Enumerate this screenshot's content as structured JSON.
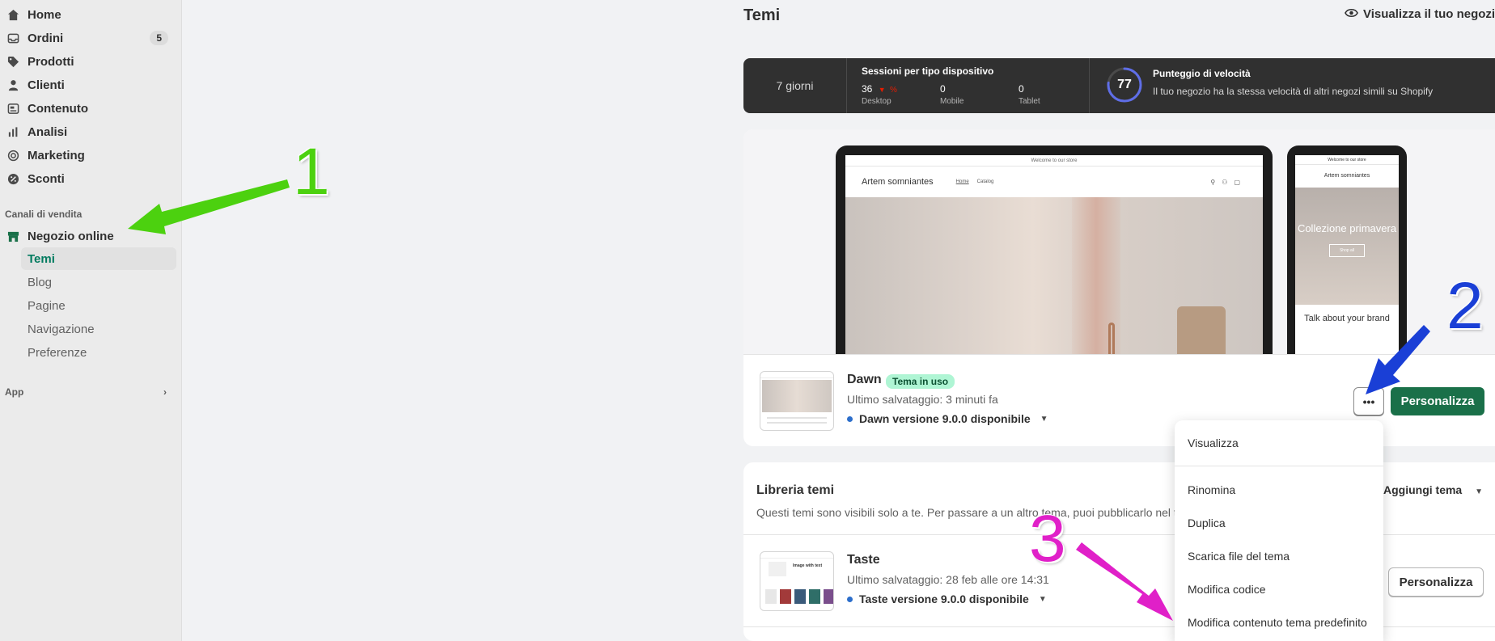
{
  "sidebar": {
    "items": [
      {
        "label": "Home",
        "icon": "home-icon"
      },
      {
        "label": "Ordini",
        "icon": "inbox-icon",
        "badge": "5"
      },
      {
        "label": "Prodotti",
        "icon": "tag-icon"
      },
      {
        "label": "Clienti",
        "icon": "person-icon"
      },
      {
        "label": "Contenuto",
        "icon": "content-icon"
      },
      {
        "label": "Analisi",
        "icon": "bar-chart-icon"
      },
      {
        "label": "Marketing",
        "icon": "target-icon"
      },
      {
        "label": "Sconti",
        "icon": "discount-icon"
      }
    ],
    "section_label": "Canali di vendita",
    "channel": {
      "label": "Negozio online",
      "icon": "store-icon"
    },
    "subitems": [
      {
        "label": "Temi",
        "active": true
      },
      {
        "label": "Blog"
      },
      {
        "label": "Pagine"
      },
      {
        "label": "Navigazione"
      },
      {
        "label": "Preferenze"
      }
    ],
    "app_label": "App"
  },
  "header": {
    "title": "Temi",
    "view_store": "Visualizza il tuo negozio"
  },
  "stats": {
    "period": "7 giorni",
    "sessions_label": "Sessioni per tipo dispositivo",
    "desktop_value": "36",
    "desktop_trend": "%",
    "desktop_label": "Desktop",
    "mobile_value": "0",
    "mobile_label": "Mobile",
    "tablet_value": "0",
    "tablet_label": "Tablet",
    "speed_score": "77",
    "speed_fraction": 0.77,
    "speed_title": "Punteggio di velocità",
    "speed_desc": "Il tuo negozio ha la stessa velocità di altri negozi simili su Shopify"
  },
  "preview": {
    "announcement": "Welcome to our store",
    "store_name": "Artem somniantes",
    "nav_home": "Home",
    "nav_catalog": "Catalog",
    "phone_announcement": "Welcome to our store",
    "phone_store_name": "Artem somniantes",
    "phone_hero_title": "Collezione primavera",
    "phone_hero_button": "Shop all",
    "phone_talk": "Talk about your brand"
  },
  "current_theme": {
    "name": "Dawn",
    "tag": "Tema in uso",
    "saved": "Ultimo salvataggio: 3 minuti fa",
    "version": "Dawn versione 9.0.0 disponibile",
    "more_label": "•••",
    "customize": "Personalizza"
  },
  "library": {
    "title": "Libreria temi",
    "desc": "Questi temi sono visibili solo a te. Per passare a un altro tema, puoi pubblicarlo nel tuo",
    "add_theme": "Aggiungi tema",
    "theme": {
      "name": "Taste",
      "saved": "Ultimo salvataggio: 28 feb alle ore 14:31",
      "version": "Taste versione 9.0.0 disponibile",
      "customize": "Personalizza",
      "thumb_text": "Image with text"
    }
  },
  "dropdown": {
    "items": [
      "Visualizza",
      "Rinomina",
      "Duplica",
      "Scarica file del tema",
      "Modifica codice",
      "Modifica contenuto tema predefinito"
    ]
  },
  "annotations": {
    "one": "1",
    "two": "2",
    "three": "3",
    "color_one": "#4cd10f",
    "color_two": "#1a3fd6",
    "color_three": "#e020c8"
  },
  "colors": {
    "accent": "#1a7049",
    "active_text": "#007a5e",
    "tag_bg": "#aff5d4",
    "dark_bar": "#303030"
  }
}
